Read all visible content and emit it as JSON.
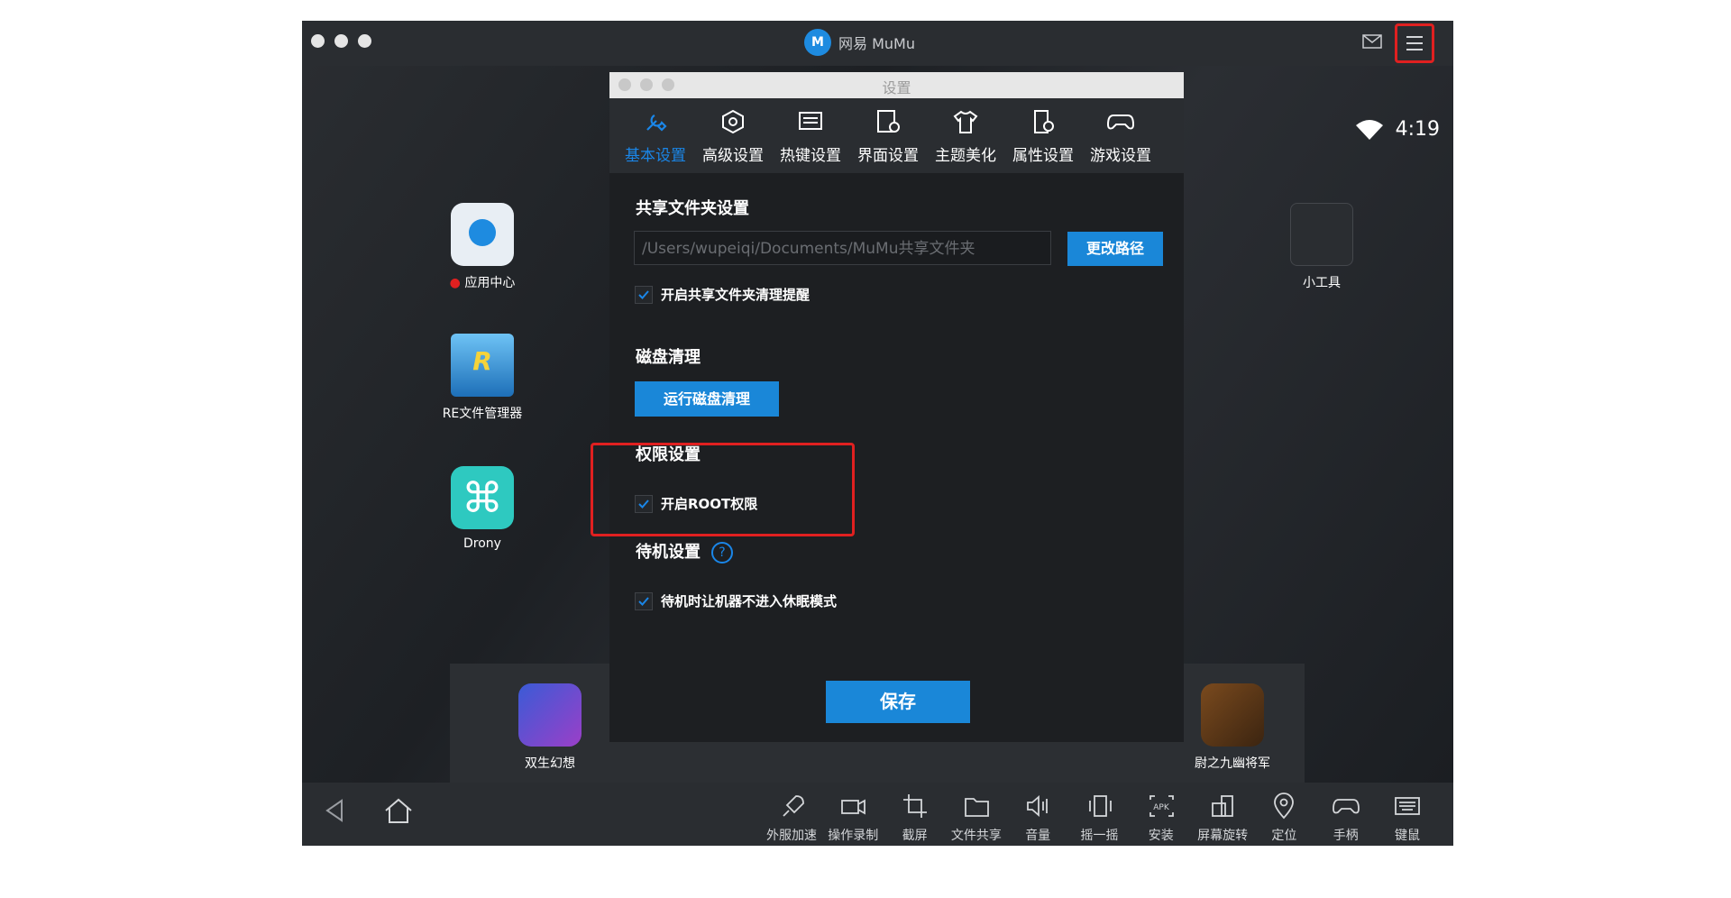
{
  "window": {
    "title": "网易 MuMu",
    "logo_text": "M",
    "time": "4:19"
  },
  "desktop_icons": [
    {
      "name": "应用中心",
      "has_dot": true
    },
    {
      "name": "RE文件管理器"
    },
    {
      "name": "Drony"
    },
    {
      "name": "小工具"
    }
  ],
  "dock_icons": [
    {
      "name": "双生幻想"
    },
    {
      "name": "尉之九幽将军"
    }
  ],
  "dialog": {
    "title": "设置",
    "tabs": [
      {
        "label": "基本设置",
        "icon": "wrench-icon",
        "active": true
      },
      {
        "label": "高级设置",
        "icon": "hexagon-icon"
      },
      {
        "label": "热键设置",
        "icon": "keyboard-icon"
      },
      {
        "label": "界面设置",
        "icon": "screen-gear-icon"
      },
      {
        "label": "主题美化",
        "icon": "tshirt-icon"
      },
      {
        "label": "属性设置",
        "icon": "phone-gear-icon"
      },
      {
        "label": "游戏设置",
        "icon": "gamepad-icon"
      }
    ],
    "shared_folder": {
      "title": "共享文件夹设置",
      "path": "/Users/wupeiqi/Documents/MuMu共享文件夹",
      "change_button": "更改路径",
      "cleanup_reminder": "开启共享文件夹清理提醒"
    },
    "disk": {
      "title": "磁盘清理",
      "button": "运行磁盘清理"
    },
    "permission": {
      "title": "权限设置",
      "root_label": "开启ROOT权限"
    },
    "standby": {
      "title": "待机设置",
      "help": "?",
      "label": "待机时让机器不进入休眠模式"
    },
    "save_button": "保存"
  },
  "toolbar": [
    {
      "label": "外服加速",
      "icon": "rocket-icon"
    },
    {
      "label": "操作录制",
      "icon": "video-icon"
    },
    {
      "label": "截屏",
      "icon": "crop-icon"
    },
    {
      "label": "文件共享",
      "icon": "folder-icon"
    },
    {
      "label": "音量",
      "icon": "volume-icon"
    },
    {
      "label": "摇一摇",
      "icon": "shake-icon"
    },
    {
      "label": "安装",
      "icon": "apk-icon",
      "icon_text": "APK"
    },
    {
      "label": "屏幕旋转",
      "icon": "rotate-icon"
    },
    {
      "label": "定位",
      "icon": "location-icon"
    },
    {
      "label": "手柄",
      "icon": "gamepad-icon"
    },
    {
      "label": "键鼠",
      "icon": "keyboard-icon"
    }
  ],
  "colors": {
    "accent": "#1a87d8",
    "highlight": "#e02020",
    "background": "#202327"
  }
}
